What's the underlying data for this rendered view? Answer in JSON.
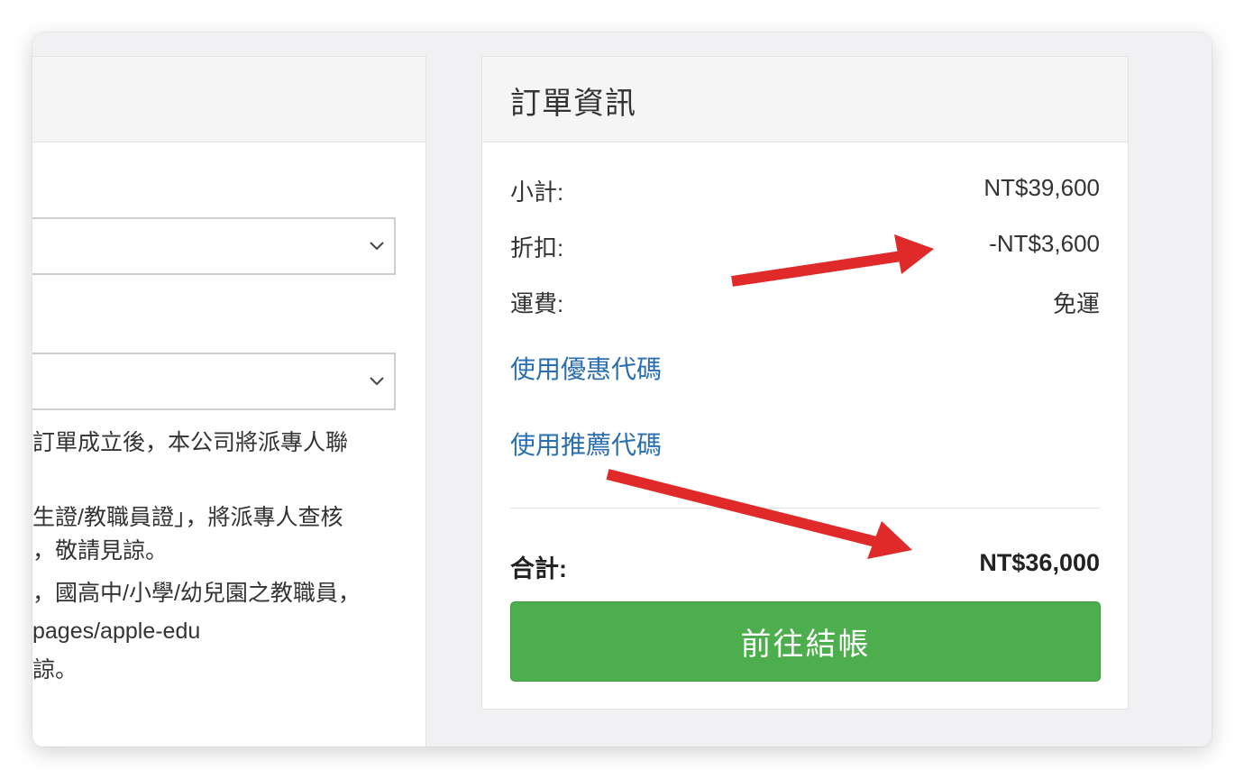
{
  "order_panel": {
    "title": "訂單資訊",
    "rows": [
      {
        "label": "小計:",
        "value": "NT$39,600"
      },
      {
        "label": "折扣:",
        "value": "-NT$3,600"
      },
      {
        "label": "運費:",
        "value": "免運"
      }
    ],
    "coupon_link": "使用優惠代碼",
    "referral_link": "使用推薦代碼",
    "total_label": "合計:",
    "total_value": "NT$36,000",
    "checkout_button": "前往結帳"
  },
  "left_panel": {
    "text_lines": [
      "訂單成立後，本公司將派專人聯",
      "生證/教職員證」，將派專人查核",
      "，敬請見諒。",
      "，國高中/小學/幼兒園之教職員，",
      "pages/apple-edu",
      "諒。"
    ]
  },
  "colors": {
    "accent_link": "#2a6fb0",
    "checkout_green": "#4cae4c",
    "annotation_arrow": "#e02a2a"
  },
  "icons": {
    "select_chevron": "chevron-down-icon",
    "annotation": "red-arrow-annotation"
  }
}
